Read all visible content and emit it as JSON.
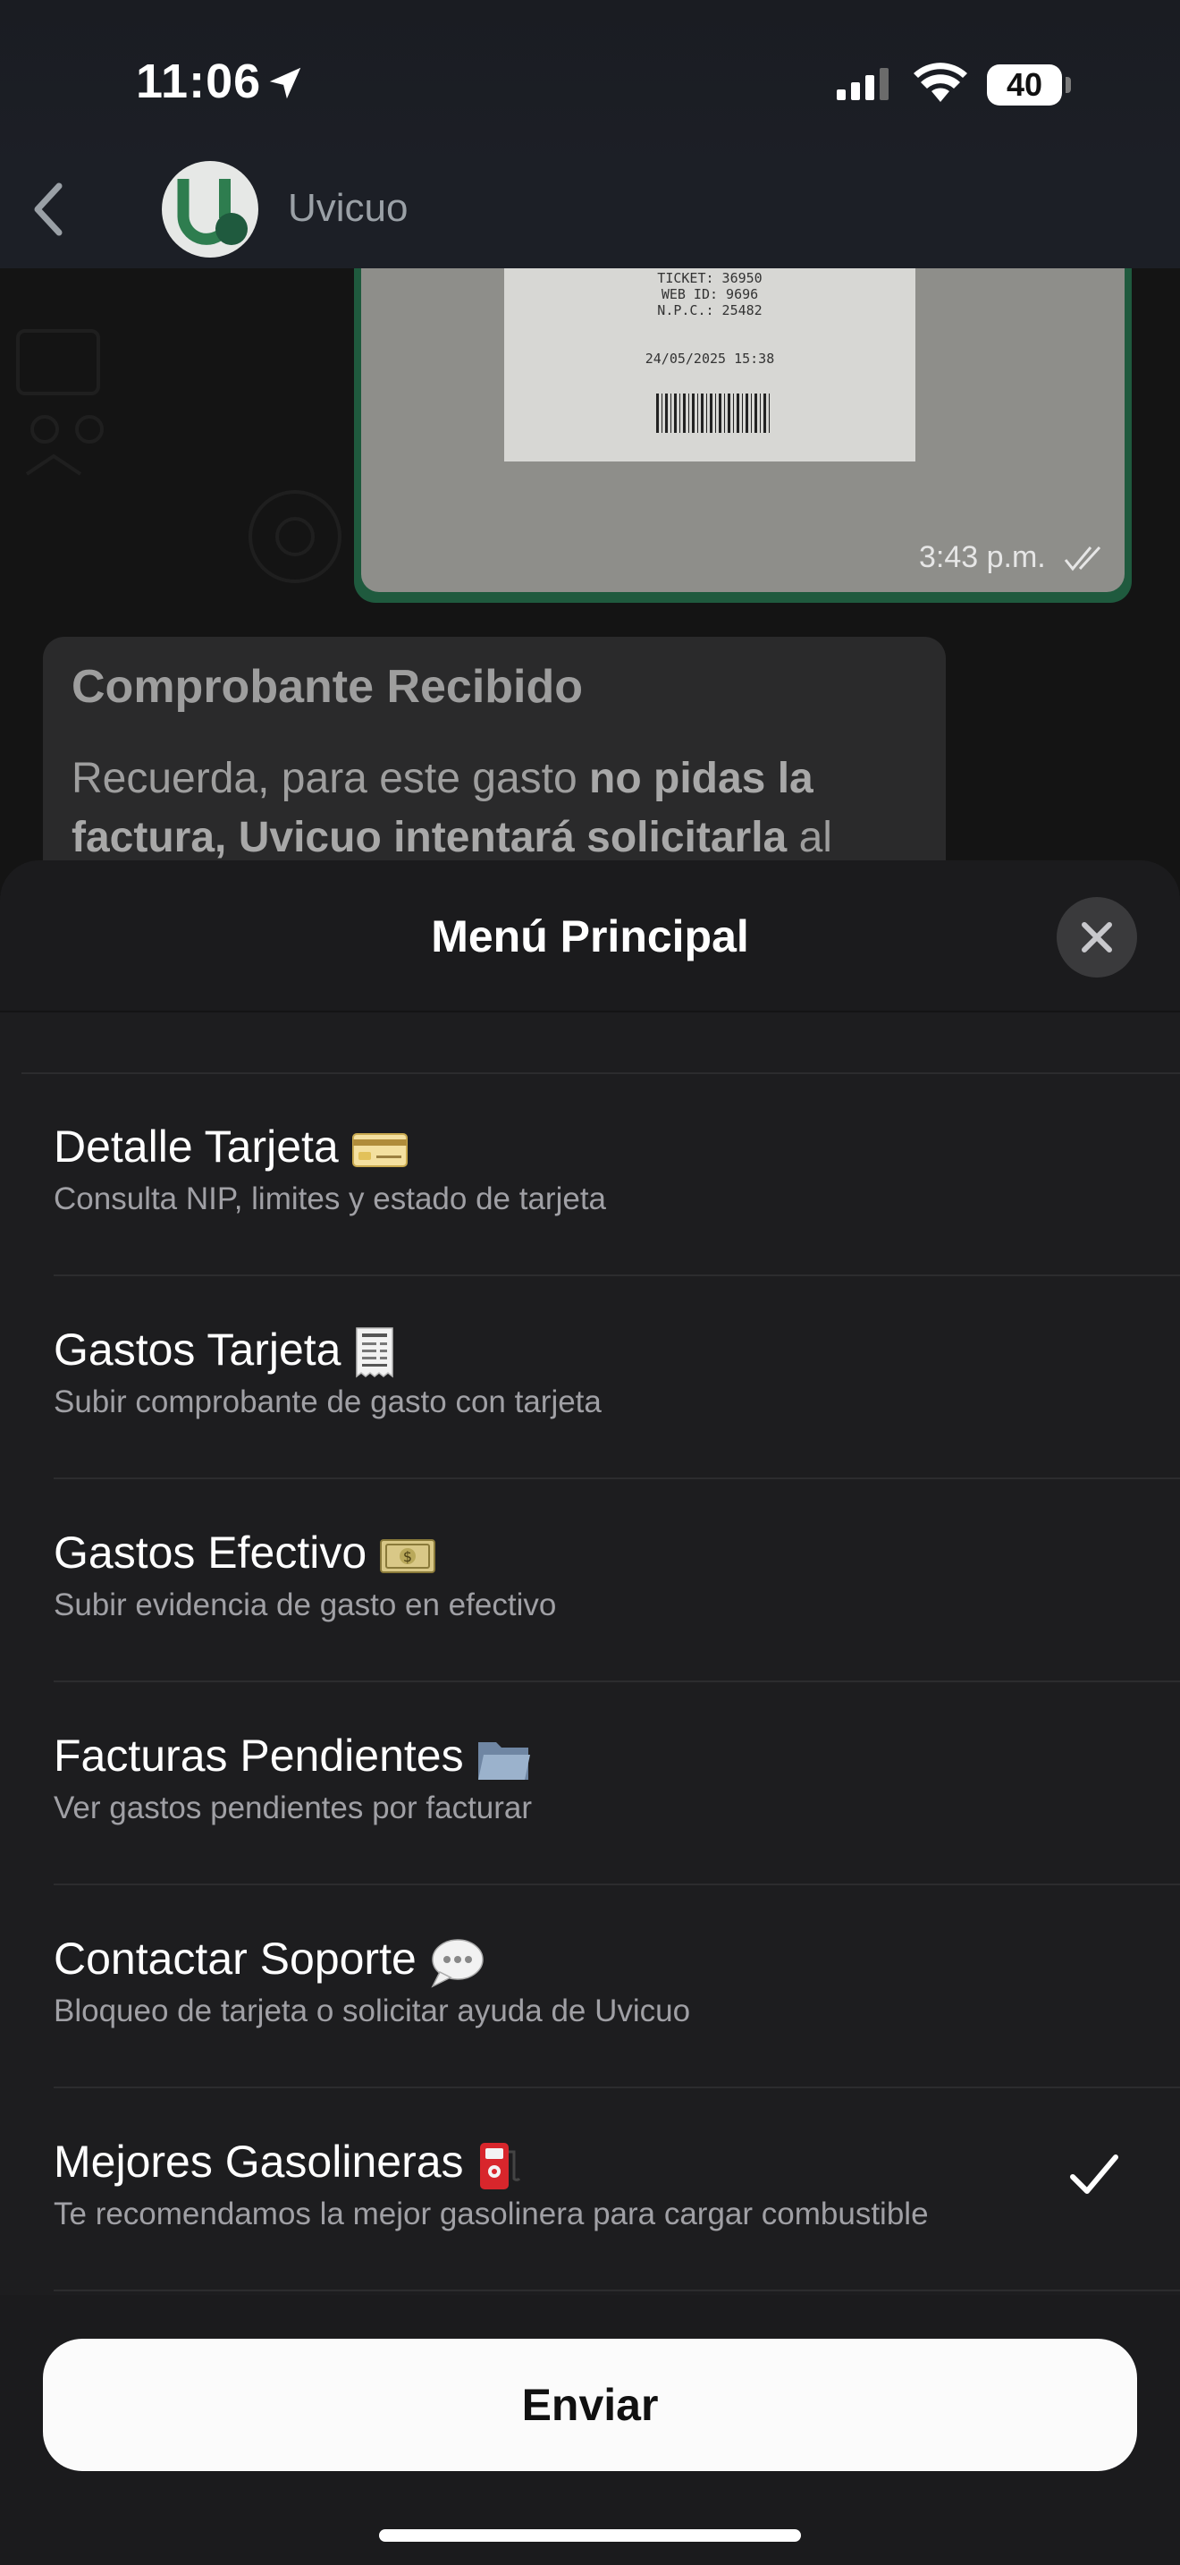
{
  "status_bar": {
    "time": "11:06",
    "battery": "40"
  },
  "chat": {
    "name": "Uvicuo",
    "receipt_lines": [
      "TICKET: 36950",
      "WEB ID: 9696",
      "N.P.C.: 25482",
      "24/05/2025 15:38"
    ],
    "image_time": "3:43 p.m.",
    "bubble_title": "Comprobante Recibido",
    "bubble_text_1": "Recuerda, para este gasto ",
    "bubble_text_bold": "no pidas la factura, Uvicuo intentará solicitarla",
    "bubble_text_2": " al"
  },
  "sheet": {
    "title": "Menú Principal",
    "options": [
      {
        "title": "Detalle Tarjeta",
        "subtitle": "Consulta NIP, limites y estado de tarjeta",
        "icon": "credit-card-icon",
        "selected": false
      },
      {
        "title": "Gastos Tarjeta",
        "subtitle": "Subir comprobante de gasto con tarjeta",
        "icon": "receipt-icon",
        "selected": false
      },
      {
        "title": "Gastos Efectivo",
        "subtitle": "Subir evidencia de gasto en efectivo",
        "icon": "money-icon",
        "selected": false
      },
      {
        "title": "Facturas Pendientes",
        "subtitle": "Ver gastos pendientes por facturar",
        "icon": "folder-icon",
        "selected": false
      },
      {
        "title": "Contactar Soporte",
        "subtitle": "Bloqueo de tarjeta o solicitar ayuda de Uvicuo",
        "icon": "speech-bubble-icon",
        "selected": false
      },
      {
        "title": "Mejores Gasolineras",
        "subtitle": "Te recomendamos la mejor gasolinera para cargar combustible",
        "icon": "fuel-pump-icon",
        "selected": true
      }
    ],
    "send_label": "Enviar"
  },
  "colors": {
    "brand_green": "#2e7d4f",
    "sheet_bg": "#1d1d1f",
    "bubble_border": "#1f5a3e"
  }
}
